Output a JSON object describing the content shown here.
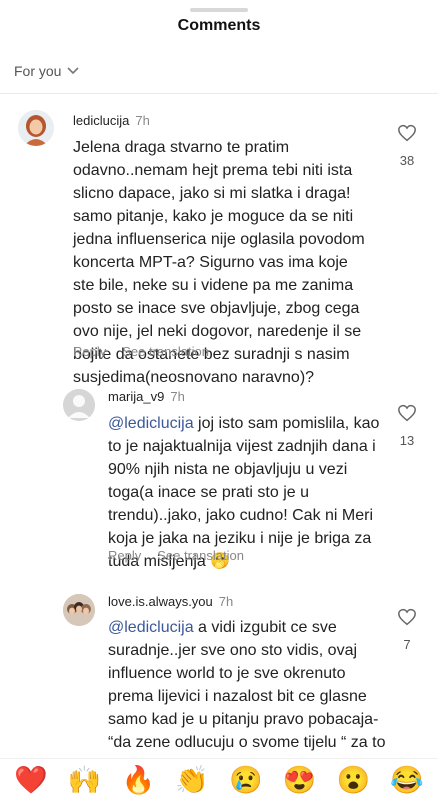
{
  "header": {
    "title": "Comments"
  },
  "filter": {
    "label": "For you"
  },
  "comments": [
    {
      "username": "lediclucija",
      "time": "7h",
      "text": "Jelena draga stvarno te pratim odavno..nemam hejt prema tebi niti ista slicno dapace, jako si mi slatka i draga! samo pitanje, kako je moguce da se niti jedna influenserica nije oglasila povodom koncerta MPT-a? Sigurno vas ima koje ste bile, neke su i videne pa me zanima posto se inace sve objavljuje, zbog cega ovo nije, jel neki dogovor, naredenje il se bojite da ostanete bez suradnji s nasim susjedima(neosnovano naravno)?",
      "reply_label": "Reply",
      "translate_label": "See translation",
      "likes": "38"
    },
    {
      "username": "marija_v9",
      "time": "7h",
      "mention": "@lediclucija",
      "text": " joj isto sam pomislila, kao to je najaktualnija vijest zadnjih dana i 90% njih nista ne objavljuju u vezi toga(a inace se prati sto je u trendu)..jako, jako cudno! Cak ni Meri koja je jaka na jeziku i nije je briga za tuda misljenja 🫢",
      "reply_label": "Reply",
      "translate_label": "See translation",
      "likes": "13"
    },
    {
      "username": "love.is.always.you",
      "time": "7h",
      "mention": "@lediclucija",
      "text": " a vidi izgubit ce sve suradnje..jer sve ono sto vidis, ovaj influence world to je sve okrenuto prema lijevici i nazalost bit ce glasne samo kad je u pitanju pravo pobacaja- “da zene odlucuju o svome tijelu “ za to ce biti placene i bit ce zvane na evente i to Ovo je strogo poslovno, mi",
      "likes": "7"
    }
  ],
  "emoji_bar": [
    "❤️",
    "🙌",
    "🔥",
    "👏",
    "😢",
    "😍",
    "😮",
    "😂"
  ]
}
